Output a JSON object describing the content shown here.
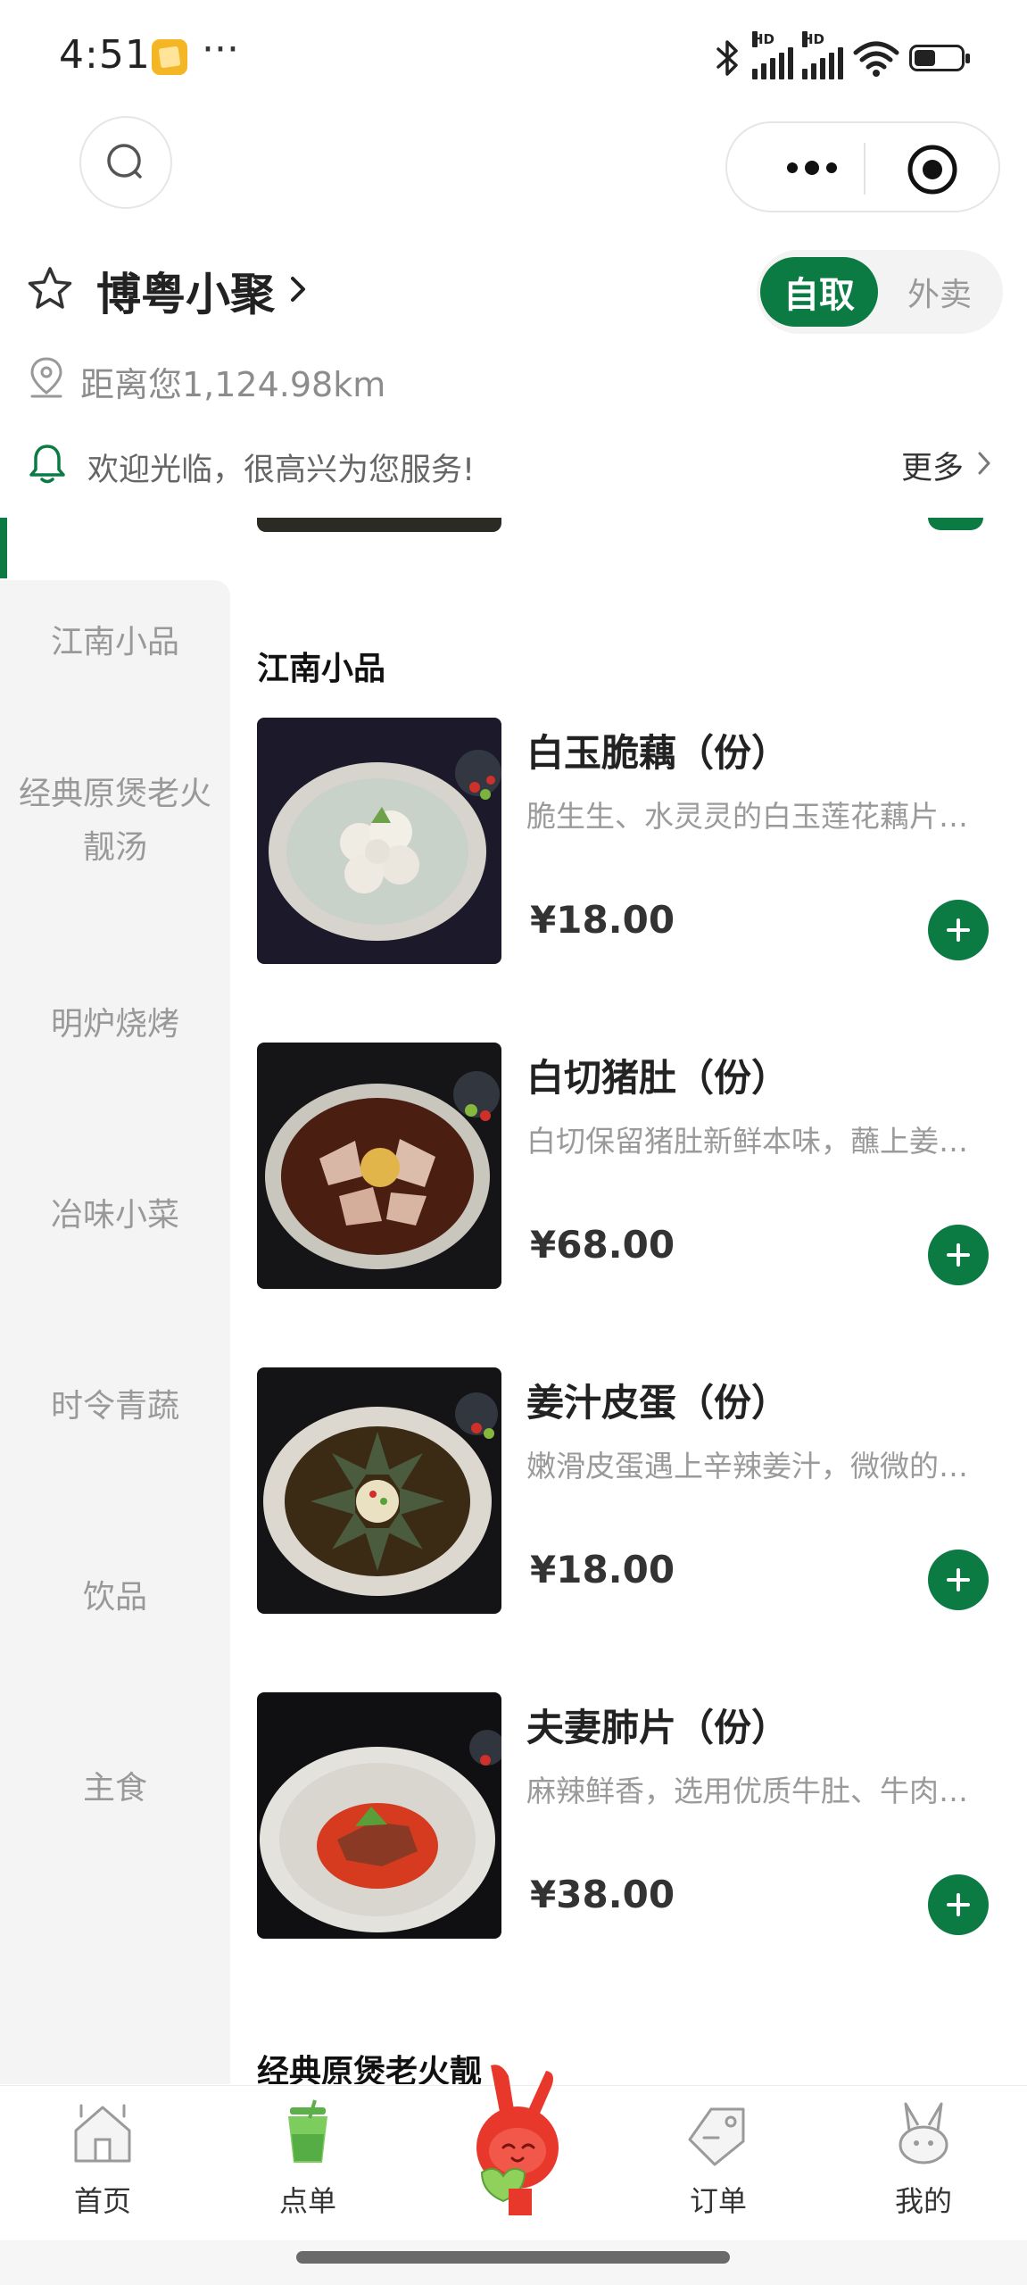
{
  "status_bar": {
    "time": "4:51",
    "more": "···",
    "icons": [
      "bluetooth-icon",
      "signal-hd-icon",
      "signal-hd-icon",
      "wifi-icon",
      "battery-icon"
    ],
    "signal_label_1": "HD",
    "signal_label_2": "HD",
    "battery_level": 0.45
  },
  "top_bar": {
    "search_icon": "search-icon",
    "menu_icon": "more-dots-icon",
    "close_icon": "target-icon"
  },
  "shop": {
    "name": "博粤小聚",
    "favorite_icon": "star-outline-icon",
    "distance": "距离您1,124.98km",
    "mode_pickup": "自取",
    "mode_delivery": "外卖",
    "notice": "欢迎光临，很高兴为您服务!",
    "notice_more": "更多"
  },
  "sidebar": {
    "items": [
      {
        "label": "江南小品"
      },
      {
        "label_line1": "经典原煲老火",
        "label_line2": "靓汤"
      },
      {
        "label": "明炉烧烤"
      },
      {
        "label": "冶味小菜"
      },
      {
        "label": "时令青蔬"
      },
      {
        "label": "饮品"
      },
      {
        "label": "主食"
      }
    ]
  },
  "menu": {
    "section_title": "江南小品",
    "next_section_title": "经典原煲老火靓",
    "currency": "¥",
    "dishes": [
      {
        "name": "白玉脆藕（份）",
        "desc": "脆生生、水灵灵的白玉莲花藕片，清甜爽口",
        "price": "¥18.00"
      },
      {
        "name": "白切猪肚（份）",
        "desc": "白切保留猪肚新鲜本味，蘸上姜葱酱汁更美味",
        "price": "¥68.00"
      },
      {
        "name": "姜汁皮蛋（份）",
        "desc": "嫩滑皮蛋遇上辛辣姜汁，微微的辛香开胃",
        "price": "¥18.00"
      },
      {
        "name": "夫妻肺片（份）",
        "desc": "麻辣鲜香，选用优质牛肚、牛肉等食材精制",
        "price": "¥38.00"
      }
    ]
  },
  "tab_bar": {
    "tabs": [
      {
        "label": "首页",
        "icon": "home-icon"
      },
      {
        "label": "点单",
        "icon": "cup-icon"
      },
      {
        "label": "",
        "icon": "mascot-icon"
      },
      {
        "label": "订单",
        "icon": "tag-icon"
      },
      {
        "label": "我的",
        "icon": "bunny-icon"
      }
    ]
  },
  "colors": {
    "brand_green": "#0b7a43",
    "sidebar_bg": "#f4f4f4",
    "muted_text": "#999999"
  }
}
